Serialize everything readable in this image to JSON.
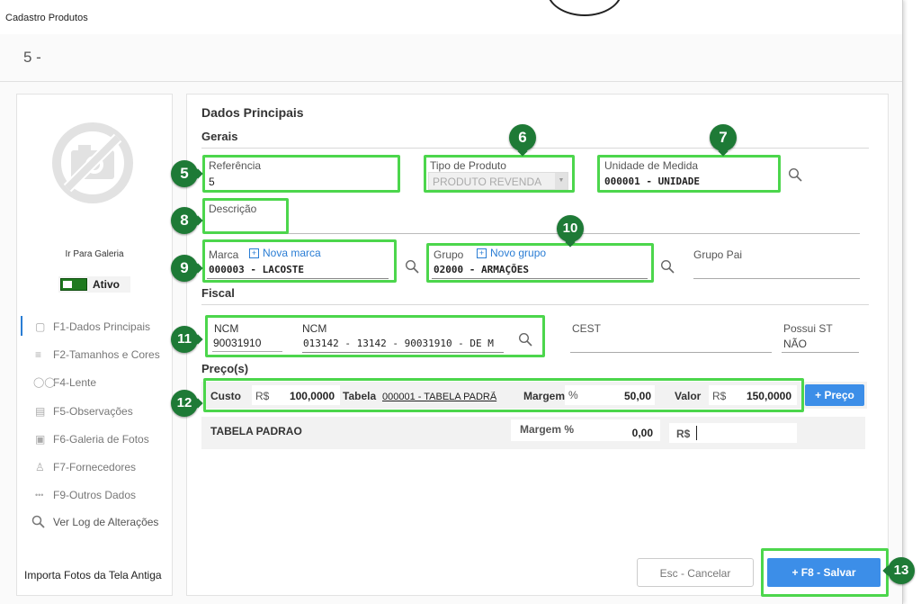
{
  "window": {
    "title": "Cadastro Produtos",
    "header": "5 -"
  },
  "sidebar": {
    "goto_gallery": "Ir Para Galeria",
    "status_label": "Ativo",
    "nav": [
      {
        "label": "F1-Dados Principais",
        "icon": "square-icon"
      },
      {
        "label": "F2-Tamanhos  e Cores",
        "icon": "list-icon"
      },
      {
        "label": "F4-Lente",
        "icon": "glasses-icon"
      },
      {
        "label": "F5-Observações",
        "icon": "note-icon"
      },
      {
        "label": "F6-Galeria de Fotos",
        "icon": "camera-icon"
      },
      {
        "label": "F7-Fornecedores",
        "icon": "supplier-icon"
      },
      {
        "label": "F9-Outros Dados",
        "icon": "dots-icon"
      },
      {
        "label": "Ver Log de Alterações",
        "icon": "search-icon"
      }
    ],
    "import_photos": "Importa Fotos da Tela Antiga"
  },
  "form": {
    "title": "Dados Principais",
    "section_general": "Gerais",
    "referencia": {
      "label": "Referência",
      "value": "5"
    },
    "tipo_produto": {
      "label": "Tipo de Produto",
      "value": "PRODUTO REVENDA"
    },
    "unidade": {
      "label": "Unidade de Medida",
      "value": "000001 - UNIDADE"
    },
    "descricao": {
      "label": "Descrição",
      "value": ""
    },
    "marca": {
      "label": "Marca",
      "new_link": "Nova marca",
      "value": "000003 - LACOSTE"
    },
    "grupo": {
      "label": "Grupo",
      "new_link": "Novo grupo",
      "value": "02000 - ARMAÇÕES"
    },
    "grupo_pai": {
      "label": "Grupo Pai",
      "value": ""
    },
    "section_fiscal": "Fiscal",
    "ncm_code": {
      "label": "NCM",
      "value": "90031910"
    },
    "ncm_desc": {
      "label": "NCM",
      "value": "013142 - 13142 - 90031910 - DE M"
    },
    "cest": {
      "label": "CEST",
      "value": ""
    },
    "possui_st": {
      "label": "Possui ST",
      "value": "NÃO"
    },
    "section_prices": "Preço(s)",
    "price_row": {
      "custo_label": "Custo",
      "currency": "R$",
      "custo_value": "100,0000",
      "tabela_label": "Tabela",
      "tabela_value": "000001 - TABELA PADRÃ",
      "margem_label": "Margem",
      "percent": "%",
      "margem_value": "50,00",
      "valor_label": "Valor",
      "valor_value": "150,0000",
      "add_price_button": "+ Preço"
    },
    "table_row": {
      "name": "TABELA PADRAO",
      "margem_label": "Margem %",
      "margem_value": "0,00",
      "currency": "R$"
    }
  },
  "buttons": {
    "cancel": "Esc - Cancelar",
    "save": "+   F8 - Salvar"
  },
  "annotations": [
    "5",
    "6",
    "7",
    "8",
    "9",
    "10",
    "11",
    "12",
    "13"
  ],
  "colors": {
    "highlight": "#4cd64c",
    "badge": "#1e7a36",
    "primary": "#3c8ee8",
    "link": "#2a7dd4"
  }
}
